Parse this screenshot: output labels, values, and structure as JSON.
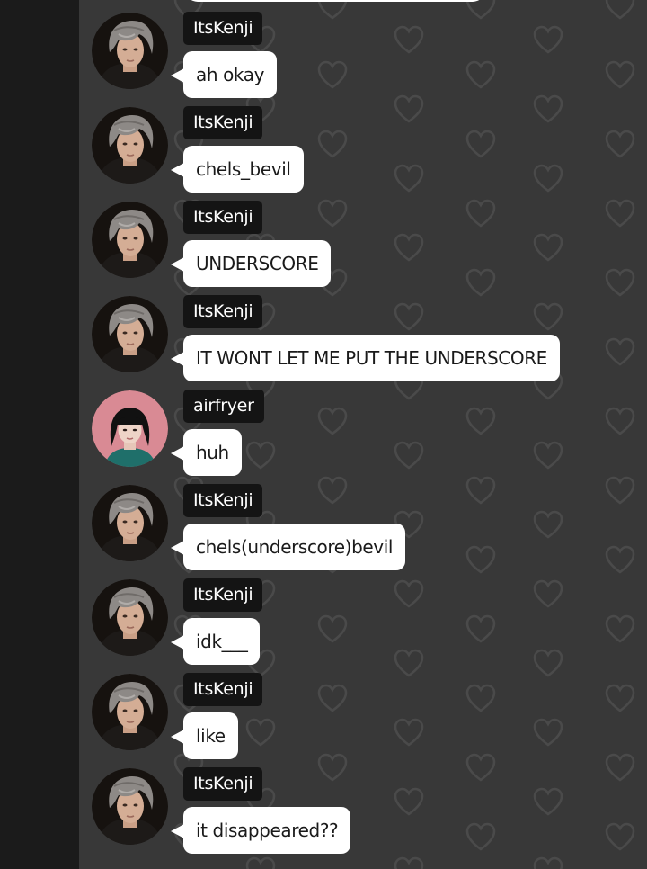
{
  "chat": {
    "messages": [
      {
        "username": "ItsKenji",
        "text": "ah okay",
        "avatar": "kenji"
      },
      {
        "username": "ItsKenji",
        "text": "chels_bevil",
        "avatar": "kenji"
      },
      {
        "username": "ItsKenji",
        "text": "UNDERSCORE",
        "avatar": "kenji"
      },
      {
        "username": "ItsKenji",
        "text": "IT WONT LET ME PUT THE UNDERSCORE",
        "avatar": "kenji"
      },
      {
        "username": "airfryer",
        "text": "huh",
        "avatar": "airfryer"
      },
      {
        "username": "ItsKenji",
        "text": "chels(underscore)bevil",
        "avatar": "kenji"
      },
      {
        "username": "ItsKenji",
        "text": "idk___",
        "avatar": "kenji"
      },
      {
        "username": "ItsKenji",
        "text": "like",
        "avatar": "kenji"
      },
      {
        "username": "ItsKenji",
        "text": "it disappeared??",
        "avatar": "kenji"
      }
    ]
  },
  "colors": {
    "chat_background": "#383838",
    "left_rail": "#1b1b1b",
    "bubble": "#ffffff",
    "bubble_text": "#1a1a1a",
    "name_tag": "#141414",
    "name_text": "#ffffff",
    "airfryer_avatar_bg": "#d98a94"
  },
  "icons": {
    "background_pattern": "heart-outline-icon",
    "kenji_avatar": "avatar-gray-hair-portrait",
    "airfryer_avatar": "avatar-black-hair-pink-bg"
  }
}
